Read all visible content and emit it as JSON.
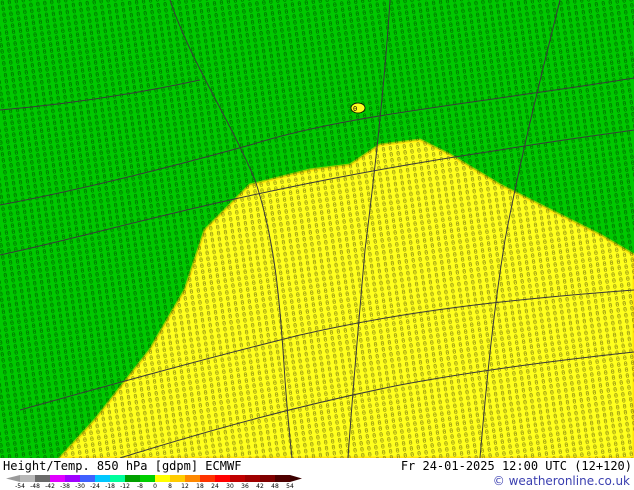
{
  "header": {
    "title": "Height/Temp. 850 hPa [gdpm] ECMWF",
    "datetime": "Fr 24-01-2025 12:00 UTC (12+120)",
    "credit": "© weatheronline.co.uk"
  },
  "legend": {
    "ticks": [
      "-54",
      "-48",
      "-42",
      "-38",
      "-30",
      "-24",
      "-18",
      "-12",
      "-8",
      "0",
      "8",
      "12",
      "18",
      "24",
      "30",
      "36",
      "42",
      "48",
      "54"
    ],
    "colors": [
      "#b8b8b8",
      "#6a6a6a",
      "#e100ff",
      "#a000ff",
      "#4060ff",
      "#00c8ff",
      "#00ff9c",
      "#00a000",
      "#00d000",
      "#ffff00",
      "#ffcc00",
      "#ff8800",
      "#ff3300",
      "#ff0000",
      "#c00000",
      "#a00000",
      "#800000",
      "#500000"
    ]
  },
  "map": {
    "cold_color": "#00c800",
    "warm_color": "#ffff1e",
    "contour_color": "#3a3a3a"
  }
}
